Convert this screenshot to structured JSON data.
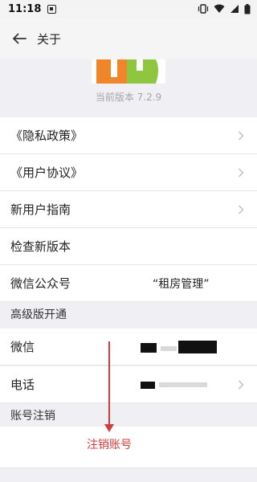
{
  "status_bar": {
    "time": "11:18"
  },
  "title_bar": {
    "title": "关于"
  },
  "header": {
    "version": "当前版本 7.2.9"
  },
  "list_top": [
    {
      "label": "《隐私政策》",
      "chevron": true
    },
    {
      "label": "《用户协议》",
      "chevron": true
    },
    {
      "label": "新用户指南",
      "chevron": true
    },
    {
      "label": "检查新版本",
      "chevron": false
    },
    {
      "label": "微信公众号",
      "value": "“租房管理”",
      "chevron": false
    }
  ],
  "sections": {
    "premium": "高级版开通",
    "account": "账号注销"
  },
  "premium_items": [
    {
      "label": "微信"
    },
    {
      "label": "电话"
    }
  ],
  "annotation": {
    "text": "注销账号"
  },
  "colors": {
    "accent_red": "#d43b3b",
    "logo_orange": "#f0862a",
    "logo_green": "#8ec63f"
  }
}
